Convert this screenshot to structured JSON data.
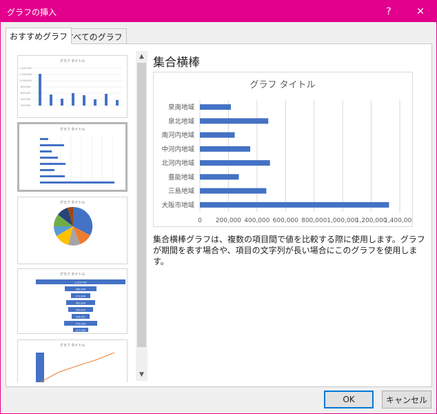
{
  "window": {
    "title": "グラフの挿入",
    "help_label": "?",
    "close_label": "✕"
  },
  "tabs": [
    {
      "label": "おすすめグラフ",
      "active": true
    },
    {
      "label": "すべてのグラフ",
      "active": false
    }
  ],
  "thumbnails": [
    {
      "name": "集合縦棒",
      "title": "グラフ タイトル"
    },
    {
      "name": "集合横棒",
      "title": "グラフ タイトル",
      "selected": true
    },
    {
      "name": "円",
      "title": "グラフ タイトル"
    },
    {
      "name": "じょうご",
      "title": "グラフ タイトル",
      "values": [
        "1,324,742",
        "465,405",
        "272,843",
        "400,834",
        "352,613",
        "244,051",
        "479,000",
        "217,000"
      ]
    },
    {
      "name": "パレート図",
      "title": "グラフ タイトル"
    }
  ],
  "preview": {
    "name": "集合横棒",
    "description": "集合横棒グラフは、複数の項目間で値を比較する際に使用します。グラフが期間を表す場合や、項目の文字列が長い場合にこのグラフを使用します。"
  },
  "chart_data": {
    "type": "bar",
    "orientation": "horizontal",
    "title": "グラフ タイトル",
    "categories": [
      "大阪市地域",
      "三島地域",
      "豊能地域",
      "北河内地域",
      "中河内地域",
      "南河内地域",
      "泉北地域",
      "泉南地域"
    ],
    "values": [
      1324742,
      465405,
      272843,
      490834,
      352613,
      244051,
      479000,
      217000
    ],
    "xlim": [
      0,
      1400000
    ],
    "xticks": [
      "0",
      "200,000",
      "400,000",
      "600,000",
      "800,000",
      "1,000,000",
      "1,200,000",
      "1,400,000"
    ],
    "grid": true,
    "color": "#4472c4"
  },
  "buttons": {
    "ok": "OK",
    "cancel": "キャンセル"
  }
}
